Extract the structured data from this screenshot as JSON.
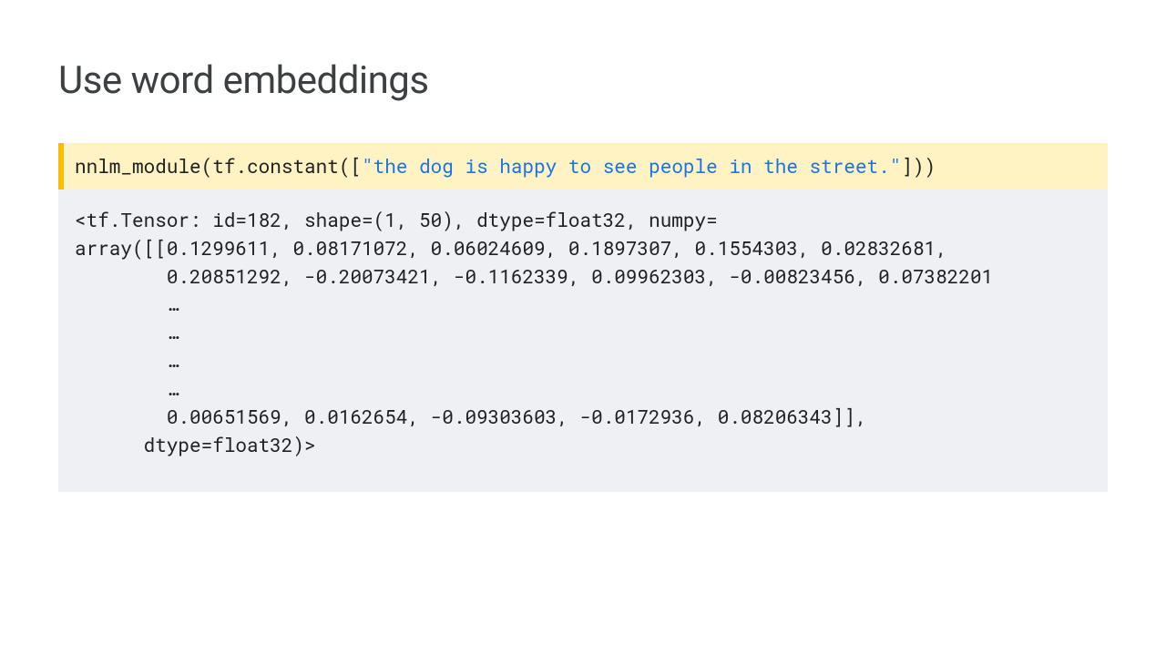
{
  "title": "Use word embeddings",
  "code": {
    "prefix": "nnlm_module(tf.constant([",
    "string": "\"the dog is happy to see people in the street.\"",
    "suffix": "]))"
  },
  "output": {
    "line1": "<tf.Tensor: id=182, shape=(1, 50), dtype=float32, numpy=",
    "line2": "array([[0.1299611, 0.08171072, 0.06024609, 0.1897307, 0.1554303, 0.02832681,",
    "line3": "        0.20851292, -0.20073421, -0.1162339, 0.09962303, -0.00823456, 0.07382201",
    "line4": "        …",
    "line5": "        …",
    "line6": "        …",
    "line7": "        …",
    "line8": "        0.00651569, 0.0162654, -0.09303603, -0.0172936, 0.08206343]],",
    "line9": "      dtype=float32)>"
  }
}
